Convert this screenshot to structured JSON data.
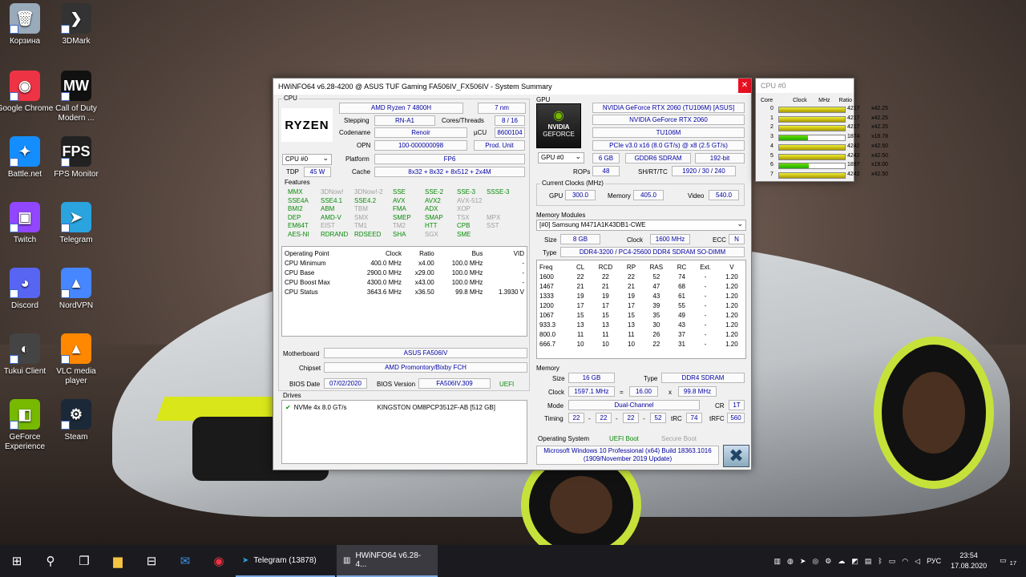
{
  "desktop": {
    "icons": [
      {
        "label": "Корзина",
        "glyph": "🗑",
        "color": "#9ab"
      },
      {
        "label": "3DMark",
        "glyph": "❯",
        "color": "#333"
      },
      {
        "label": "Google Chrome",
        "glyph": "◉",
        "color": "#e34"
      },
      {
        "label": "Call of Duty Modern ...",
        "glyph": "MW",
        "color": "#111"
      },
      {
        "label": "Battle.net",
        "glyph": "✦",
        "color": "#148eff"
      },
      {
        "label": "FPS Monitor",
        "glyph": "FPS",
        "color": "#222"
      },
      {
        "label": "Twitch",
        "glyph": "▣",
        "color": "#9146ff"
      },
      {
        "label": "Telegram",
        "glyph": "➤",
        "color": "#2aa3df"
      },
      {
        "label": "Discord",
        "glyph": "◕",
        "color": "#5865f2"
      },
      {
        "label": "NordVPN",
        "glyph": "▲",
        "color": "#4687ff"
      },
      {
        "label": "Tukui Client",
        "glyph": "◐",
        "color": "#444"
      },
      {
        "label": "VLC media player",
        "glyph": "▲",
        "color": "#f80"
      },
      {
        "label": "GeForce Experience",
        "glyph": "◧",
        "color": "#76b900"
      },
      {
        "label": "Steam",
        "glyph": "⚙",
        "color": "#1b2838"
      }
    ]
  },
  "window": {
    "title": "HWiNFO64 v6.28-4200 @ ASUS TUF Gaming FA506IV_FX506IV - System Summary",
    "close": "✕",
    "cpu": {
      "section": "CPU",
      "logo": "RYZEN",
      "name": "AMD Ryzen 7 4800H",
      "nm": "7 nm",
      "stepping_label": "Stepping",
      "stepping": "RN-A1",
      "cores_label": "Cores/Threads",
      "cores": "8 / 16",
      "codename_label": "Codename",
      "codename": "Renoir",
      "ucu_label": "µCU",
      "ucu": "8600104",
      "opn_label": "OPN",
      "opn": "100-000000098",
      "prod": "Prod. Unit",
      "select": "CPU #0",
      "platform_label": "Platform",
      "platform": "FP6",
      "tdp_label": "TDP",
      "tdp": "45 W",
      "cache_label": "Cache",
      "cache": "8x32 + 8x32 + 8x512 + 2x4M",
      "features_label": "Features",
      "features": [
        [
          {
            "t": "MMX",
            "on": true
          },
          {
            "t": "3DNow!",
            "on": false
          },
          {
            "t": "3DNow!-2",
            "on": false
          },
          {
            "t": "SSE",
            "on": true
          },
          {
            "t": "SSE-2",
            "on": true
          },
          {
            "t": "SSE-3",
            "on": true
          },
          {
            "t": "SSSE-3",
            "on": true
          }
        ],
        [
          {
            "t": "SSE4A",
            "on": true
          },
          {
            "t": "SSE4.1",
            "on": true
          },
          {
            "t": "SSE4.2",
            "on": true
          },
          {
            "t": "AVX",
            "on": true
          },
          {
            "t": "AVX2",
            "on": true
          },
          {
            "t": "AVX-512",
            "on": false
          },
          {
            "t": "",
            "on": false
          }
        ],
        [
          {
            "t": "BMI2",
            "on": true
          },
          {
            "t": "ABM",
            "on": true
          },
          {
            "t": "TBM",
            "on": false
          },
          {
            "t": "FMA",
            "on": true
          },
          {
            "t": "ADX",
            "on": true
          },
          {
            "t": "XOP",
            "on": false
          },
          {
            "t": "",
            "on": false
          }
        ],
        [
          {
            "t": "DEP",
            "on": true
          },
          {
            "t": "AMD-V",
            "on": true
          },
          {
            "t": "SMX",
            "on": false
          },
          {
            "t": "SMEP",
            "on": true
          },
          {
            "t": "SMAP",
            "on": true
          },
          {
            "t": "TSX",
            "on": false
          },
          {
            "t": "MPX",
            "on": false
          }
        ],
        [
          {
            "t": "EM64T",
            "on": true
          },
          {
            "t": "EIST",
            "on": false
          },
          {
            "t": "TM1",
            "on": false
          },
          {
            "t": "TM2",
            "on": false
          },
          {
            "t": "HTT",
            "on": true
          },
          {
            "t": "CPB",
            "on": true
          },
          {
            "t": "SST",
            "on": false
          }
        ],
        [
          {
            "t": "AES-NI",
            "on": true
          },
          {
            "t": "RDRAND",
            "on": true
          },
          {
            "t": "RDSEED",
            "on": true
          },
          {
            "t": "SHA",
            "on": true
          },
          {
            "t": "SGX",
            "on": false
          },
          {
            "t": "SME",
            "on": true
          },
          {
            "t": "",
            "on": false
          }
        ]
      ],
      "op_headers": [
        "Operating Point",
        "Clock",
        "Ratio",
        "Bus",
        "VID"
      ],
      "op_rows": [
        [
          "CPU Minimum",
          "400.0 MHz",
          "x4.00",
          "100.0 MHz",
          "-"
        ],
        [
          "CPU Base",
          "2900.0 MHz",
          "x29.00",
          "100.0 MHz",
          "-"
        ],
        [
          "CPU Boost Max",
          "4300.0 MHz",
          "x43.00",
          "100.0 MHz",
          "-"
        ],
        [
          "CPU Status",
          "3643.6 MHz",
          "x36.50",
          "99.8 MHz",
          "1.3930 V"
        ]
      ],
      "mb_label": "Motherboard",
      "mb": "ASUS FA506IV",
      "chipset_label": "Chipset",
      "chipset": "AMD Promontory/Bixby FCH",
      "biosdate_label": "BIOS Date",
      "biosdate": "07/02/2020",
      "biosver_label": "BIOS Version",
      "biosver": "FA506IV.309",
      "uefi": "UEFI",
      "drives_label": "Drives",
      "drive_type": "NVMe 4x 8.0 GT/s",
      "drive_name": "KINGSTON OM8PCP3512F-AB [512 GB]"
    },
    "gpu": {
      "section": "GPU",
      "logo1": "NVIDIA",
      "logo2": "GEFORCE",
      "name": "NVIDIA GeForce RTX 2060 (TU106M) [ASUS]",
      "name2": "NVIDIA GeForce RTX 2060",
      "chip": "TU106M",
      "bus": "PCIe v3.0 x16 (8.0 GT/s) @ x8 (2.5 GT/s)",
      "select": "GPU #0",
      "vram": "6 GB",
      "vtype": "GDDR6 SDRAM",
      "vbus": "192-bit",
      "rops_label": "ROPs",
      "rops": "48",
      "shrt_label": "SH/RT/TC",
      "shrt": "1920 / 30 / 240",
      "clocks_label": "Current Clocks (MHz)",
      "gpu_label": "GPU",
      "gpu_clk": "300.0",
      "mem_label": "Memory",
      "mem_clk": "405.0",
      "video_label": "Video",
      "video_clk": "540.0"
    },
    "modules": {
      "label": "Memory Modules",
      "select": "[#0] Samsung M471A1K43DB1-CWE",
      "size_label": "Size",
      "size": "8 GB",
      "clock_label": "Clock",
      "clock": "1600 MHz",
      "ecc_label": "ECC",
      "ecc": "N",
      "type_label": "Type",
      "type": "DDR4-3200 / PC4-25600 DDR4 SDRAM SO-DIMM",
      "headers": [
        "Freq",
        "CL",
        "RCD",
        "RP",
        "RAS",
        "RC",
        "Ext.",
        "V"
      ],
      "rows": [
        [
          "1600",
          "22",
          "22",
          "22",
          "52",
          "74",
          "-",
          "1.20"
        ],
        [
          "1467",
          "21",
          "21",
          "21",
          "47",
          "68",
          "-",
          "1.20"
        ],
        [
          "1333",
          "19",
          "19",
          "19",
          "43",
          "61",
          "-",
          "1.20"
        ],
        [
          "1200",
          "17",
          "17",
          "17",
          "39",
          "55",
          "-",
          "1.20"
        ],
        [
          "1067",
          "15",
          "15",
          "15",
          "35",
          "49",
          "-",
          "1.20"
        ],
        [
          "933.3",
          "13",
          "13",
          "13",
          "30",
          "43",
          "-",
          "1.20"
        ],
        [
          "800.0",
          "11",
          "11",
          "11",
          "26",
          "37",
          "-",
          "1.20"
        ],
        [
          "666.7",
          "10",
          "10",
          "10",
          "22",
          "31",
          "-",
          "1.20"
        ]
      ]
    },
    "memory": {
      "label": "Memory",
      "size_label": "Size",
      "size": "16 GB",
      "type_label": "Type",
      "type": "DDR4 SDRAM",
      "clock_label": "Clock",
      "clock": "1597.1 MHz",
      "eq": "=",
      "mult": "16.00",
      "x": "x",
      "bus": "99.8 MHz",
      "mode_label": "Mode",
      "mode": "Dual-Channel",
      "cr_label": "CR",
      "cr": "1T",
      "timing_label": "Timing",
      "t1": "22",
      "t2": "22",
      "t3": "22",
      "t4": "52",
      "dash": "-",
      "trc_label": "tRC",
      "trc": "74",
      "trfc_label": "tRFC",
      "trfc": "560"
    },
    "os": {
      "label": "Operating System",
      "uefi": "UEFI Boot",
      "secure": "Secure Boot",
      "line1": "Microsoft Windows 10 Professional (x64) Build 18363.1016",
      "line2": "(1909/November 2019 Update)"
    }
  },
  "cpu_window": {
    "title": "CPU #0",
    "headers": [
      "Core",
      "Clock",
      "MHz",
      "Ratio"
    ],
    "cores": [
      {
        "core": "0",
        "mhz": "4217",
        "ratio": "x42.25",
        "frac": 1.0
      },
      {
        "core": "1",
        "mhz": "4217",
        "ratio": "x42.25",
        "frac": 1.0
      },
      {
        "core": "2",
        "mhz": "4217",
        "ratio": "x42.25",
        "frac": 1.0
      },
      {
        "core": "3",
        "mhz": "1874",
        "ratio": "x18.78",
        "frac": 0.44
      },
      {
        "core": "4",
        "mhz": "4242",
        "ratio": "x42.50",
        "frac": 1.0
      },
      {
        "core": "5",
        "mhz": "4242",
        "ratio": "x42.50",
        "frac": 1.0
      },
      {
        "core": "6",
        "mhz": "1897",
        "ratio": "x19.00",
        "frac": 0.45
      },
      {
        "core": "7",
        "mhz": "4242",
        "ratio": "x42.50",
        "frac": 1.0
      }
    ]
  },
  "taskbar": {
    "apps": [
      {
        "label": "Telegram (13878)"
      },
      {
        "label": "HWiNFO64 v6.28-4..."
      }
    ],
    "lang": "РУС",
    "time": "23:54",
    "date": "17.08.2020",
    "notif": "17"
  }
}
